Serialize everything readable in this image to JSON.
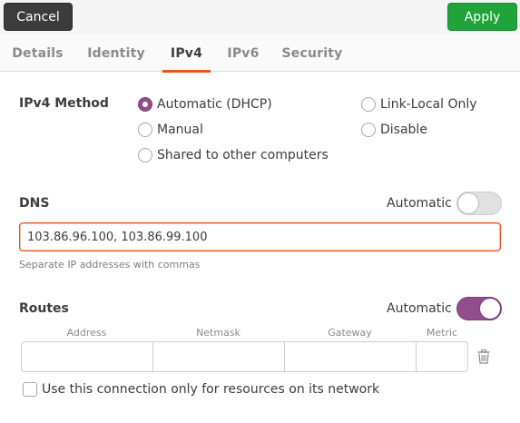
{
  "header": {
    "cancel_label": "Cancel",
    "apply_label": "Apply",
    "apply_color": "#1fa33a"
  },
  "tabs": [
    {
      "label": "Details",
      "active": false
    },
    {
      "label": "Identity",
      "active": false
    },
    {
      "label": "IPv4",
      "active": true
    },
    {
      "label": "IPv6",
      "active": false
    },
    {
      "label": "Security",
      "active": false
    }
  ],
  "ipv4_method": {
    "label": "IPv4 Method",
    "options": [
      {
        "label": "Automatic (DHCP)",
        "checked": true
      },
      {
        "label": "Manual",
        "checked": false
      },
      {
        "label": "Shared to other computers",
        "checked": false
      },
      {
        "label": "Link-Local Only",
        "checked": false
      },
      {
        "label": "Disable",
        "checked": false
      }
    ]
  },
  "dns": {
    "label": "DNS",
    "automatic_label": "Automatic",
    "automatic_on": false,
    "value": "103.86.96.100, 103.86.99.100",
    "hint": "Separate IP addresses with commas"
  },
  "routes": {
    "label": "Routes",
    "automatic_label": "Automatic",
    "automatic_on": true,
    "columns": [
      "Address",
      "Netmask",
      "Gateway",
      "Metric"
    ],
    "delete_icon": "trash-icon"
  },
  "only_local": {
    "label": "Use this connection only for resources on its network",
    "checked": false
  },
  "colors": {
    "accent": "#e95420",
    "toggle_on": "#924d8b"
  }
}
